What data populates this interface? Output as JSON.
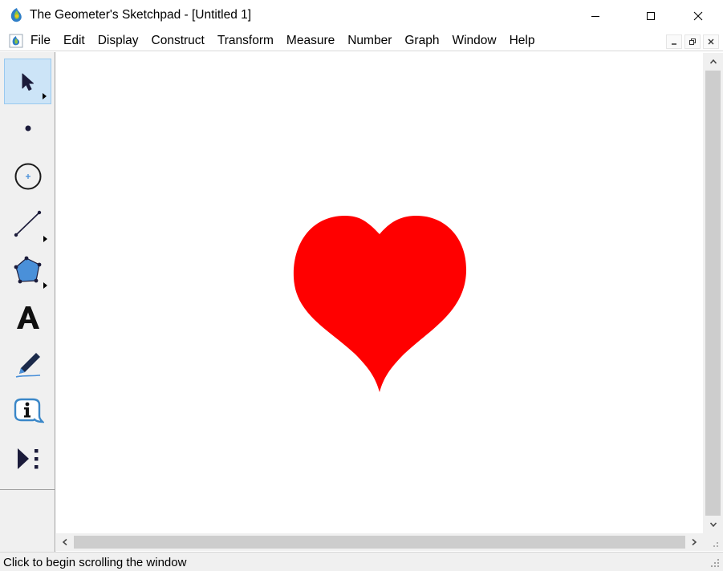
{
  "window": {
    "title": "The Geometer's Sketchpad - [Untitled 1]",
    "icon": "sketchpad-logo-icon",
    "controls": [
      "minimize-icon",
      "maximize-icon",
      "close-icon"
    ]
  },
  "menubar": {
    "doc_icon": "sketchpad-document-icon",
    "items": [
      "File",
      "Edit",
      "Display",
      "Construct",
      "Transform",
      "Measure",
      "Number",
      "Graph",
      "Window",
      "Help"
    ],
    "mdi_controls": [
      "mdi-minimize-icon",
      "mdi-restore-icon",
      "mdi-close-icon"
    ]
  },
  "toolbox": {
    "selected_tool": "selection-arrow-tool",
    "tools": [
      {
        "name": "selection-arrow-tool",
        "icon": "arrow-pointer-icon",
        "has_submenu": true
      },
      {
        "name": "point-tool",
        "icon": "point-icon",
        "has_submenu": false
      },
      {
        "name": "compass-tool",
        "icon": "circle-icon",
        "has_submenu": false
      },
      {
        "name": "straightedge-tool",
        "icon": "segment-icon",
        "has_submenu": true
      },
      {
        "name": "polygon-tool",
        "icon": "pentagon-icon",
        "has_submenu": true
      },
      {
        "name": "text-tool",
        "icon": "letter-a-icon",
        "has_submenu": false
      },
      {
        "name": "marker-tool",
        "icon": "marker-pen-icon",
        "has_submenu": false
      },
      {
        "name": "information-tool",
        "icon": "info-bubble-icon",
        "has_submenu": false
      },
      {
        "name": "custom-tool",
        "icon": "play-dots-icon",
        "has_submenu": false
      }
    ]
  },
  "canvas": {
    "shapes": [
      {
        "type": "heart",
        "fill": "#ff0000"
      }
    ]
  },
  "colors": {
    "heart": "#ff0000",
    "selected_tool_bg": "#cce4f7",
    "chrome": "#f0f0f0",
    "scroll_thumb": "#cdcdcd"
  },
  "statusbar": {
    "text": "Click to begin scrolling the window"
  }
}
